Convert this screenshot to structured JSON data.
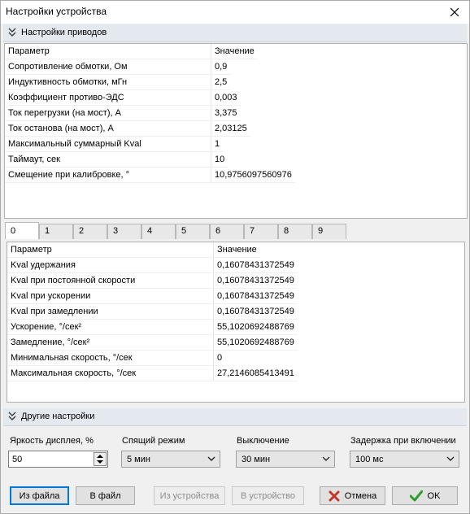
{
  "window": {
    "title": "Настройки устройства"
  },
  "drives_section": {
    "title": "Настройки приводов"
  },
  "drives_table": {
    "headers": [
      "Параметр",
      "Значение"
    ],
    "rows": [
      [
        "Сопротивление обмотки, Ом",
        "0,9"
      ],
      [
        "Индуктивность обмотки, мГн",
        "2,5"
      ],
      [
        "Коэффициент противо-ЭДС",
        "0,003"
      ],
      [
        "Ток перегрузки (на мост), А",
        "3,375"
      ],
      [
        "Ток останова (на мост), А",
        "2,03125"
      ],
      [
        "Максимальный суммарный Kval",
        "1"
      ],
      [
        "Таймаут, сек",
        "10"
      ],
      [
        "Смещение при калибровке, °",
        "10,9756097560976"
      ]
    ]
  },
  "tabs": [
    "0",
    "1",
    "2",
    "3",
    "4",
    "5",
    "6",
    "7",
    "8",
    "9"
  ],
  "active_tab": "0",
  "axis_table": {
    "headers": [
      "Параметр",
      "Значение"
    ],
    "rows": [
      [
        "Kval удержания",
        "0,16078431372549"
      ],
      [
        "Kval при постоянной скорости",
        "0,16078431372549"
      ],
      [
        "Kval при ускорении",
        "0,16078431372549"
      ],
      [
        "Kval при замедлении",
        "0,16078431372549"
      ],
      [
        "Ускорение, °/сек²",
        "55,1020692488769"
      ],
      [
        "Замедление, °/сек²",
        "55,1020692488769"
      ],
      [
        "Минимальная скорость, °/сек",
        "0"
      ],
      [
        "Максимальная скорость, °/сек",
        "27,2146085413491"
      ]
    ]
  },
  "other_section": {
    "title": "Другие настройки"
  },
  "other_settings": {
    "brightness_label": "Яркость дисплея, %",
    "brightness_value": "50",
    "sleep_label": "Спящий режим",
    "sleep_value": "5 мин",
    "off_label": "Выключение",
    "off_value": "30 мин",
    "delay_label": "Задержка при включении",
    "delay_value": "100 мс"
  },
  "buttons": {
    "from_file": "Из файла",
    "to_file": "В файл",
    "from_device": "Из устройства",
    "to_device": "В устройство",
    "cancel": "Отмена",
    "ok": "OK"
  },
  "colors": {
    "cancel_icon": "#c0392b",
    "ok_icon": "#2e9e2e",
    "focus": "#0078d7"
  }
}
